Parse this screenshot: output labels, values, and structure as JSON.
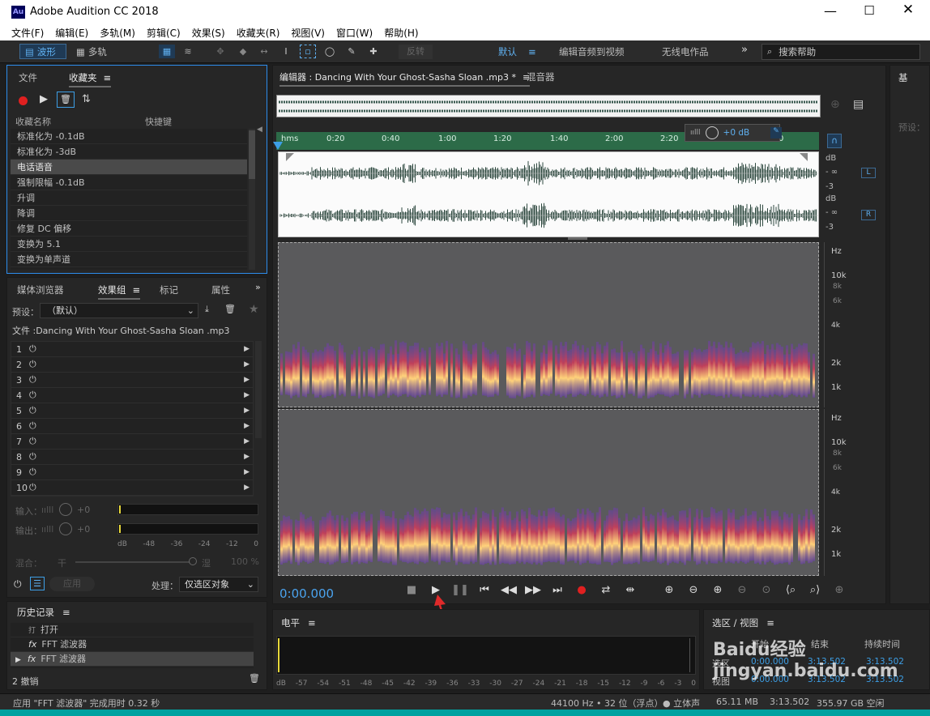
{
  "window": {
    "title": "Adobe Audition CC 2018",
    "app_icon": "Au"
  },
  "menu": [
    "文件(F)",
    "编辑(E)",
    "多轨(M)",
    "剪辑(C)",
    "效果(S)",
    "收藏夹(R)",
    "视图(V)",
    "窗口(W)",
    "帮助(H)"
  ],
  "toolbar": {
    "waveform": "波形",
    "multitrack": "多轨",
    "spin": "反转",
    "workspaces": [
      "默认",
      "编辑音频到视频",
      "无线电作品"
    ],
    "search_placeholder": "搜索帮助"
  },
  "favorites": {
    "tabs": [
      "文件",
      "收藏夹"
    ],
    "col_name": "收藏名称",
    "col_shortcut": "快捷键",
    "items": [
      "标准化为 -0.1dB",
      "标准化为 -3dB",
      "电话语音",
      "强制限幅 -0.1dB",
      "升调",
      "降调",
      "修复 DC 偏移",
      "变换为 5.1",
      "变换为单声道"
    ],
    "selected_index": 2
  },
  "effects": {
    "tabs": [
      "媒体浏览器",
      "效果组",
      "标记",
      "属性"
    ],
    "preset_label": "预设：",
    "preset_value": "（默认）",
    "file_label": "文件 :Dancing With Your Ghost-Sasha Sloan .mp3",
    "slots": [
      "1",
      "2",
      "3",
      "4",
      "5",
      "6",
      "7",
      "8",
      "9",
      "10"
    ],
    "input_label": "输入：",
    "output_label": "输出：",
    "input_value": "+0",
    "output_value": "+0",
    "meter_ticks": [
      "dB",
      "-48",
      "-36",
      "-24",
      "-12",
      "0"
    ],
    "mix_label": "混合：",
    "mix_dry": "干",
    "mix_wet": "湿",
    "mix_value": "100 %",
    "apply": "应用",
    "process_label": "处理：",
    "process_value": "仅选区对象"
  },
  "history": {
    "title": "历史记录",
    "items": [
      {
        "icon": "打",
        "label": "打开"
      },
      {
        "icon": "fx",
        "label": "FFT 滤波器"
      },
      {
        "icon": "fx",
        "label": "FFT 滤波器"
      }
    ],
    "undo": "2 撤销"
  },
  "status": {
    "message": "应用 \"FFT 滤波器\" 完成用时 0.32 秒",
    "format": "44100 Hz • 32 位（浮点）",
    "channels": "立体声",
    "size": "65.11 MB",
    "duration": "3:13.502",
    "free": "355.97 GB 空闲"
  },
  "editor": {
    "tab": "编辑器 : Dancing With Your Ghost-Sasha Sloan .mp3 *",
    "mixer": "混音器",
    "ruler": [
      "hms",
      "0:20",
      "0:40",
      "1:00",
      "1:20",
      "1:40",
      "2:00",
      "2:20",
      "0"
    ],
    "gain": "+0 dB",
    "db_labels_l": [
      "dB",
      "- ∞",
      "-3"
    ],
    "db_labels_r": [
      "dB",
      "- ∞",
      "-3"
    ],
    "ch_l": "L",
    "ch_r": "R",
    "hz_labels": [
      "Hz",
      "10k",
      "8k",
      "6k",
      "4k",
      "2k",
      "1k"
    ],
    "time": "0:00.000"
  },
  "levels": {
    "title": "电平",
    "ticks": [
      "dB",
      "-57",
      "-54",
      "-51",
      "-48",
      "-45",
      "-42",
      "-39",
      "-36",
      "-33",
      "-30",
      "-27",
      "-24",
      "-21",
      "-18",
      "-15",
      "-12",
      "-9",
      "-6",
      "-3",
      "0"
    ]
  },
  "selection": {
    "title": "选区 / 视图",
    "cols": [
      "开始",
      "结束",
      "持续时间"
    ],
    "rows": [
      {
        "label": "选区",
        "start": "0:00.000",
        "end": "3:13.502",
        "dur": "3:13.502"
      },
      {
        "label": "视图",
        "start": "0:00.000",
        "end": "3:13.502",
        "dur": "3:13.502"
      }
    ]
  },
  "right_panel": {
    "title": "基",
    "preset": "预设："
  },
  "watermark": "Baidu经验 jingyan.baidu.com"
}
